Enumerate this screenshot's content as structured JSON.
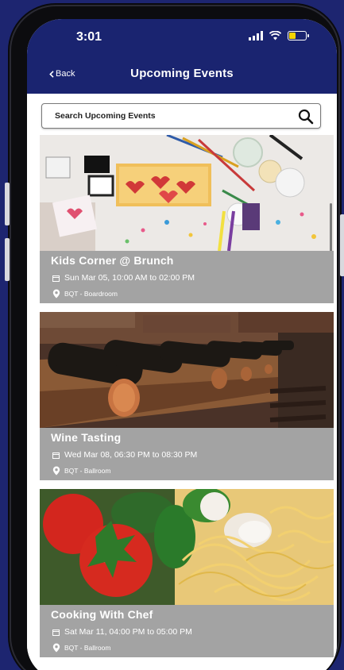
{
  "status_bar": {
    "time": "3:01",
    "battery_color": "#f5d400"
  },
  "nav": {
    "back_label": "Back",
    "title": "Upcoming Events"
  },
  "search": {
    "placeholder": "Search Upcoming Events"
  },
  "events": [
    {
      "title": "Kids Corner @ Brunch",
      "date": "Sun Mar 05, 10:00 AM to 02:00 PM",
      "location": "BQT - Boardroom",
      "image": "art-supplies-image"
    },
    {
      "title": "Wine Tasting",
      "date": "Wed Mar 08, 06:30 PM to 08:30 PM",
      "location": "BQT - Ballroom",
      "image": "wine-rack-image"
    },
    {
      "title": "Cooking With Chef",
      "date": "Sat Mar 11, 04:00 PM to 05:00 PM",
      "location": "BQT - Ballroom",
      "image": "tomato-pasta-image"
    }
  ],
  "colors": {
    "brand": "#1a2470",
    "card_overlay": "#a3a3a3",
    "background": "#1d2570"
  }
}
